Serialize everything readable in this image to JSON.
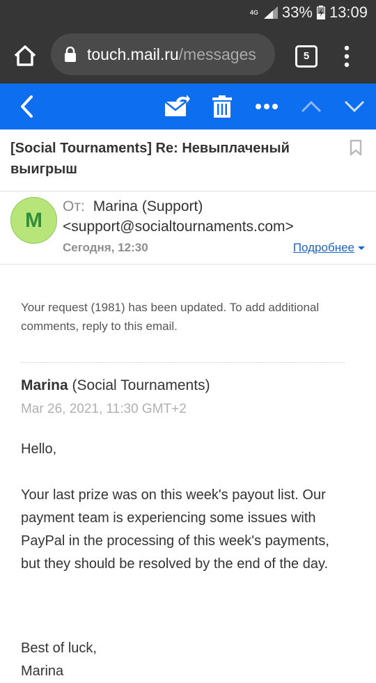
{
  "status_bar": {
    "network": "4G",
    "battery": "33%",
    "time": "13:09"
  },
  "browser": {
    "url_domain": "touch.mail.ru",
    "url_path": "/messages",
    "tab_count": "5",
    "icons": [
      "home-icon",
      "lock-icon",
      "tabs-icon",
      "more-vert-icon"
    ]
  },
  "toolbar": {
    "icons": [
      "back-icon",
      "move-to-folder-icon",
      "trash-icon",
      "more-horiz-icon",
      "prev-message-icon",
      "next-message-icon"
    ],
    "accent": "#0d6ef0"
  },
  "email": {
    "subject": "[Social Tournaments] Re: Невыплаченый выигрыш",
    "avatar_letter": "M",
    "from_label": "От:",
    "from_name": "Marina (Support)",
    "from_address": "<support@socialtournaments.com>",
    "date": "Сегодня, 12:30",
    "details_link": "Подробнее"
  },
  "body": {
    "notice": "Your request (1981) has been updated. To add additional comments, reply to this email.",
    "author_name": "Marina",
    "author_org": "(Social Tournaments)",
    "message_date": "Mar 26, 2021, 11:30 GMT+2",
    "greeting": "Hello,",
    "paragraph": "Your last prize was on this week's payout list. Our payment team is experiencing some issues with PayPal in the processing of this week's payments, but they should be resolved by the end of the day.",
    "signoff": "Best of luck,",
    "signature": "Marina"
  }
}
